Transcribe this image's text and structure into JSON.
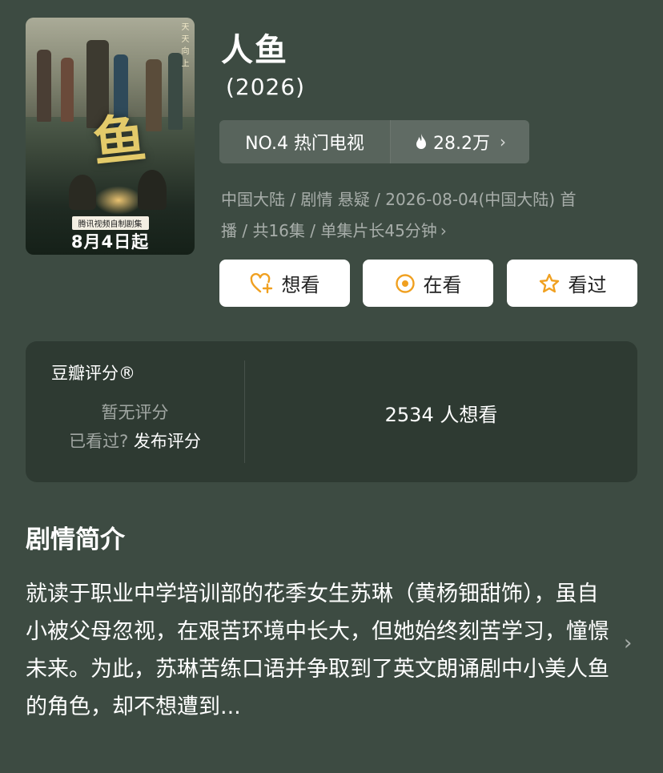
{
  "poster": {
    "calligraphy": "鱼",
    "side_text": "天 天 向 上",
    "badge": "腾讯视频自制剧集",
    "date_text": "8月4日起"
  },
  "title": "人鱼",
  "year": "(2026)",
  "ranking": {
    "rank_text": "NO.4 热门电视",
    "heat_icon": "flame-icon",
    "heat_value": "28.2万",
    "chevron": "›"
  },
  "meta": {
    "line1": "中国大陆 / 剧情 悬疑 / 2026-08-04(中国大陆) 首",
    "line2": "播 / 共16集 / 单集片长45分钟",
    "chevron": "›"
  },
  "actions": {
    "want_label": "想看",
    "watching_label": "在看",
    "watched_label": "看过"
  },
  "rating": {
    "brand": "豆瓣评分®",
    "no_score": "暂无评分",
    "watched_question": "已看过?",
    "publish_link": "发布评分",
    "wish_count": "2534 人想看"
  },
  "synopsis": {
    "title": "剧情简介",
    "text": "就读于职业中学培训部的花季女生苏琳（黄杨钿甜饰），虽自小被父母忽视，在艰苦环境中长大，但她始终刻苦学习，憧憬未来。为此，苏琳苦练口语并争取到了英文朗诵剧中小美人鱼的角色，却不想遭到...",
    "chevron": "›"
  },
  "colors": {
    "background": "#3d4b42",
    "card": "#2e3a32",
    "accent": "#f0a020"
  }
}
